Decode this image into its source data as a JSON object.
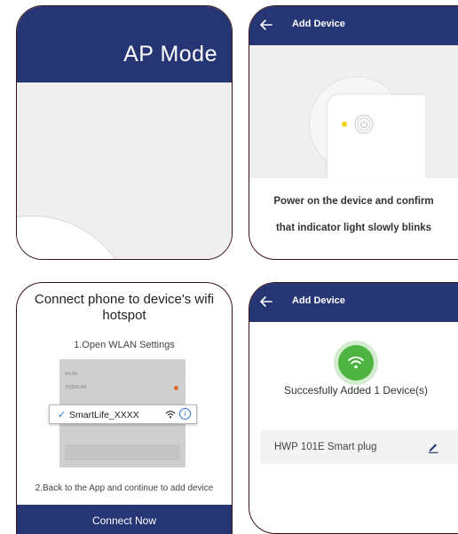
{
  "panel1": {
    "title": "AP Mode"
  },
  "panel2": {
    "appbar_title": "Add Device",
    "instruction_line1": "Power on the device and confirm",
    "instruction_line2": "that indicator light slowly blinks"
  },
  "panel3": {
    "title": "Connect phone to device's wifi hotspot",
    "step1": "1.Open WLAN Settings",
    "screenshot_rows": [
      "WLAN",
      "无线WLAN"
    ],
    "selected_network": "SmartLife_XXXX",
    "step2": "2.Back to the App and continue to add device",
    "button_label": "Connect Now"
  },
  "panel4": {
    "appbar_title": "Add Device",
    "success_message": "Succesfully Added 1 Device(s)",
    "device_name": "HWP 101E  Smart plug"
  },
  "colors": {
    "primary": "#263574",
    "success": "#4fb341",
    "indicator": "#f6d11d",
    "link": "#2a6fd6"
  }
}
